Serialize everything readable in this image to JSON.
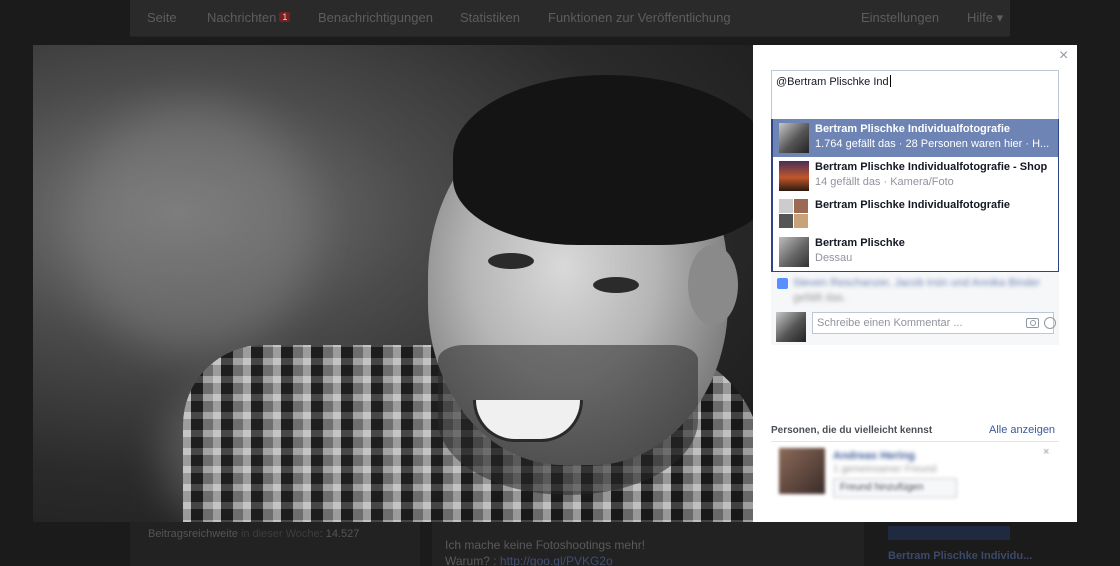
{
  "background": {
    "nav": [
      "Seite",
      "Nachrichten",
      "Benachrichtigungen",
      "Statistiken",
      "Funktionen zur Veröffentlichung",
      "Einstellungen",
      "Hilfe ▾"
    ],
    "nav_badge": "1",
    "reach_label": "Beitragsreichweite",
    "reach_suffix": "in dieser Woche",
    "reach_value": "14.527",
    "post_line1": "Ich mache keine Fotoshootings mehr!",
    "post_line2_prefix": "Warum? : ",
    "post_link": "http://goo.gl/PVKG2o",
    "side_title": "Bertram Plischke Individu..."
  },
  "panel": {
    "close": "×",
    "mention_value": "@Bertram Plischke Ind",
    "suggestions": [
      {
        "name": "Bertram Plischke Individualfotografie",
        "sub": "1.764 gefällt das · 28 Personen waren hier · H...",
        "selected": true
      },
      {
        "name": "Bertram Plischke Individualfotografie - Shop",
        "sub": "14 gefällt das · Kamera/Foto",
        "selected": false
      },
      {
        "name": "Bertram Plischke Individualfotografie",
        "sub": "",
        "selected": false
      },
      {
        "name": "Bertram Plischke",
        "sub": "Dessau",
        "selected": false
      }
    ],
    "likes_text": "Steven Reschanzer, Jacob Irsin und Annika Binder",
    "likes_suffix": "gefällt das.",
    "comment_placeholder": "Schreibe einen Kommentar ...",
    "pymk": {
      "title": "Personen, die du vielleicht kennst",
      "see_all": "Alle anzeigen",
      "person_name": "Andreas Hering",
      "person_sub": "1 gemeinsamer Freund",
      "add_label": "Freund hinzufügen",
      "dismiss": "×"
    }
  },
  "colors": {
    "accent": "#3b5998",
    "selected_row": "#6d84b4",
    "dropdown_border": "#2d4486"
  }
}
